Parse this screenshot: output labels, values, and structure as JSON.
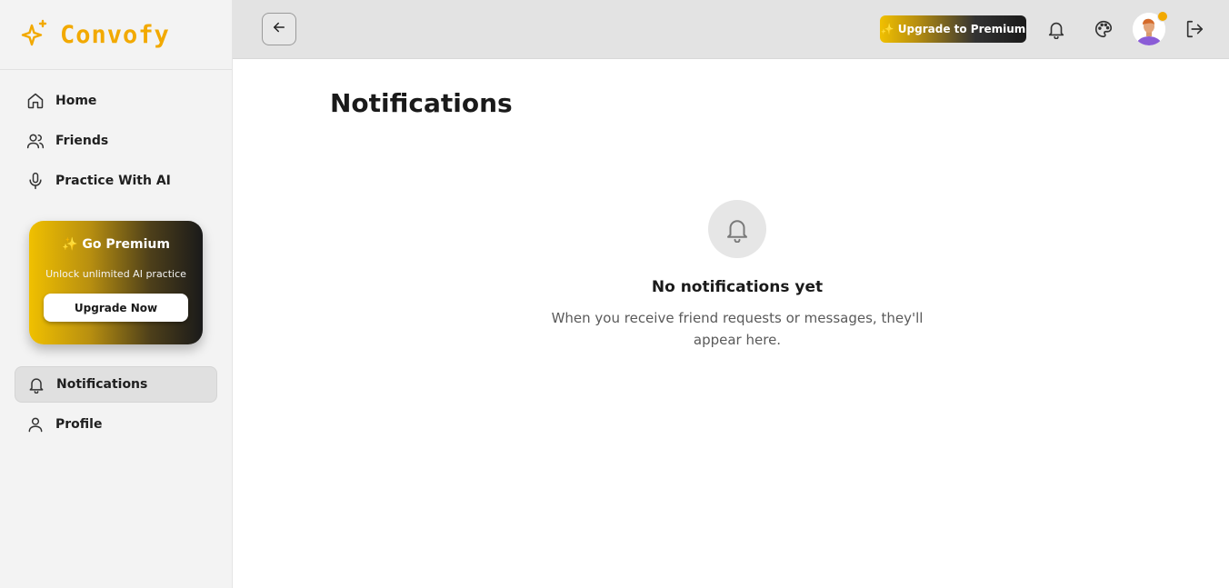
{
  "brand": {
    "name": "Convofy",
    "accent": "#f2a900"
  },
  "sidebar": {
    "items": [
      {
        "label": "Home",
        "icon": "home-icon"
      },
      {
        "label": "Friends",
        "icon": "users-icon"
      },
      {
        "label": "Practice With AI",
        "icon": "microphone-icon"
      }
    ],
    "premium": {
      "title": "✨ Go Premium",
      "subtitle": "Unlock unlimited AI practice",
      "button": "Upgrade Now"
    },
    "bottom_items": [
      {
        "label": "Notifications",
        "icon": "bell-icon",
        "active": true
      },
      {
        "label": "Profile",
        "icon": "user-icon"
      }
    ]
  },
  "header": {
    "upgrade_label": "✨ Upgrade to Premium",
    "icons": [
      "arrow-left-icon",
      "bell-icon",
      "palette-icon",
      "avatar",
      "logout-icon"
    ]
  },
  "main": {
    "title": "Notifications",
    "empty_title": "No notifications yet",
    "empty_desc": "When you receive friend requests or messages, they'll appear here."
  }
}
